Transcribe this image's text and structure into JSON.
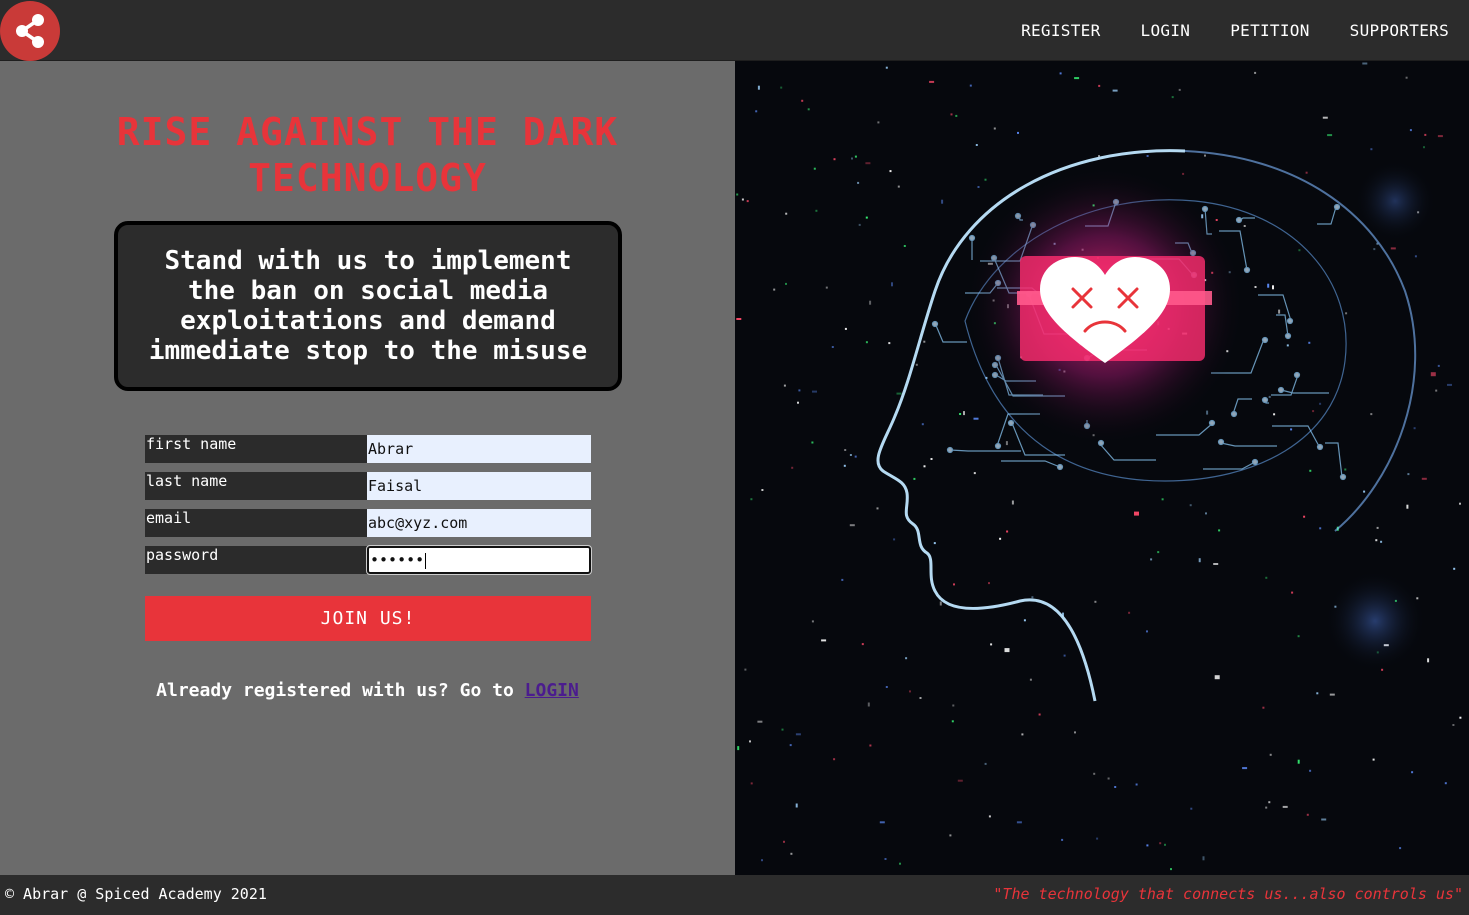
{
  "nav": {
    "items": [
      "REGISTER",
      "LOGIN",
      "PETITION",
      "SUPPORTERS"
    ]
  },
  "hero": {
    "title": "RISE AGAINST THE DARK TECHNOLOGY",
    "message": "Stand with us to implement the ban on social media exploitations and demand immediate stop to the misuse"
  },
  "form": {
    "first_name": {
      "label": "first name",
      "value": "Abrar"
    },
    "last_name": {
      "label": "last name",
      "value": "Faisal"
    },
    "email": {
      "label": "email",
      "value": "abc@xyz.com"
    },
    "password": {
      "label": "password",
      "value": "••••••"
    },
    "submit_label": "JOIN US!"
  },
  "login_prompt": {
    "text": "Already registered with us? Go to ",
    "link": "LOGIN"
  },
  "footer": {
    "copyright": "© Abrar @ Spiced Academy 2021",
    "quote": "\"The technology that connects us...also controls us\""
  },
  "colors": {
    "accent": "#e8343a",
    "header_bg": "#2c2c2c",
    "panel_bg": "#6b6b6b",
    "logo_bg": "#c93a38",
    "link": "#4b1c8e"
  },
  "icons": {
    "logo": "share-icon"
  }
}
